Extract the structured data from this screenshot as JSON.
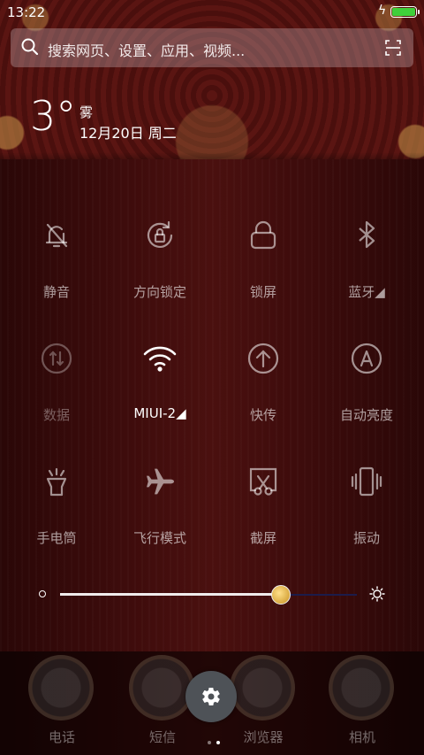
{
  "status_bar": {
    "time": "13:22",
    "battery_level": 1.0,
    "battery_color": "#3fd03a",
    "charging": true
  },
  "search": {
    "placeholder": "搜索网页、设置、应用、视频...",
    "icon": "search-icon",
    "scan_icon": "scan-icon"
  },
  "weather": {
    "temperature": "3°",
    "condition": "雾",
    "date": "12月20日 周二"
  },
  "toggles": [
    {
      "label": "静音",
      "icon": "bell-off-icon",
      "state": "off"
    },
    {
      "label": "方向锁定",
      "icon": "rotation-lock-icon",
      "state": "off"
    },
    {
      "label": "锁屏",
      "icon": "lock-icon",
      "state": "off"
    },
    {
      "label": "蓝牙◢",
      "icon": "bluetooth-icon",
      "state": "off"
    },
    {
      "label": "数据",
      "icon": "data-icon",
      "state": "disabled"
    },
    {
      "label": "MIUI-2◢",
      "icon": "wifi-icon",
      "state": "on"
    },
    {
      "label": "快传",
      "icon": "share-upload-icon",
      "state": "off"
    },
    {
      "label": "自动亮度",
      "icon": "auto-brightness-icon",
      "state": "off"
    },
    {
      "label": "手电筒",
      "icon": "flashlight-icon",
      "state": "off"
    },
    {
      "label": "飞行模式",
      "icon": "airplane-icon",
      "state": "off"
    },
    {
      "label": "截屏",
      "icon": "screenshot-icon",
      "state": "off"
    },
    {
      "label": "振动",
      "icon": "vibrate-icon",
      "state": "off"
    }
  ],
  "brightness": {
    "level": 0.74,
    "track_color": "#1c1c4a",
    "knob_color": "#e8b43a"
  },
  "dock": {
    "apps": [
      {
        "label": "电话",
        "icon": "phone-icon"
      },
      {
        "label": "短信",
        "icon": "messages-icon"
      },
      {
        "label": "浏览器",
        "icon": "browser-icon"
      },
      {
        "label": "相机",
        "icon": "camera-icon"
      }
    ],
    "settings_icon": "gear-icon",
    "page_indicator": {
      "count": 2,
      "active": 1
    }
  }
}
